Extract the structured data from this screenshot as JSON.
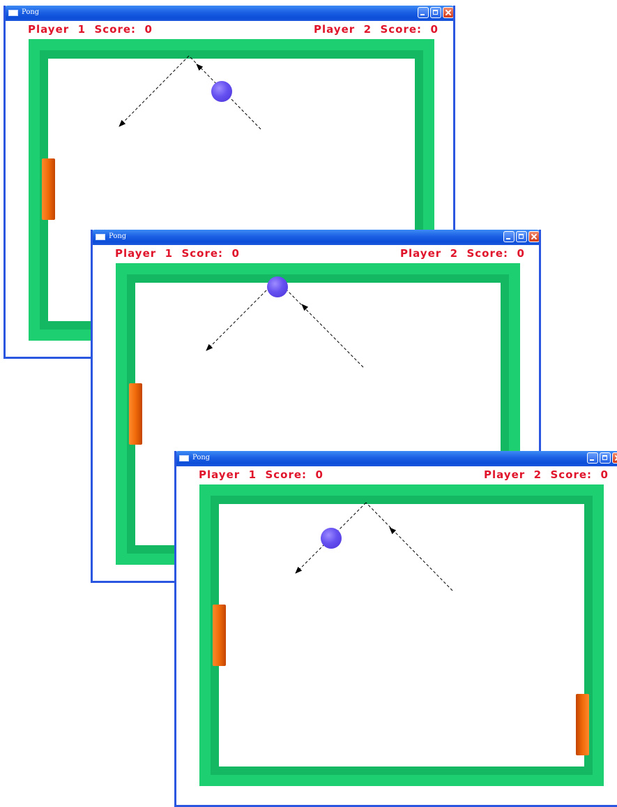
{
  "windows": [
    {
      "title": "Pong",
      "player1_score": "Player  1  Score:  0",
      "player2_score": "Player  2  Score:  0"
    },
    {
      "title": "Pong",
      "player1_score": "Player  1  Score:  0",
      "player2_score": "Player  2  Score:  0"
    },
    {
      "title": "Pong",
      "player1_score": "Player  1  Score:  0",
      "player2_score": "Player  2  Score:  0"
    }
  ],
  "colors": {
    "titlebar": "#1a5fe3",
    "score_text": "#e0142a",
    "wall": "#1ecf72",
    "paddle": "#f06a0a",
    "ball": "#6550f0"
  },
  "icons": [
    "window-icon",
    "minimize-icon",
    "maximize-icon",
    "close-icon"
  ]
}
